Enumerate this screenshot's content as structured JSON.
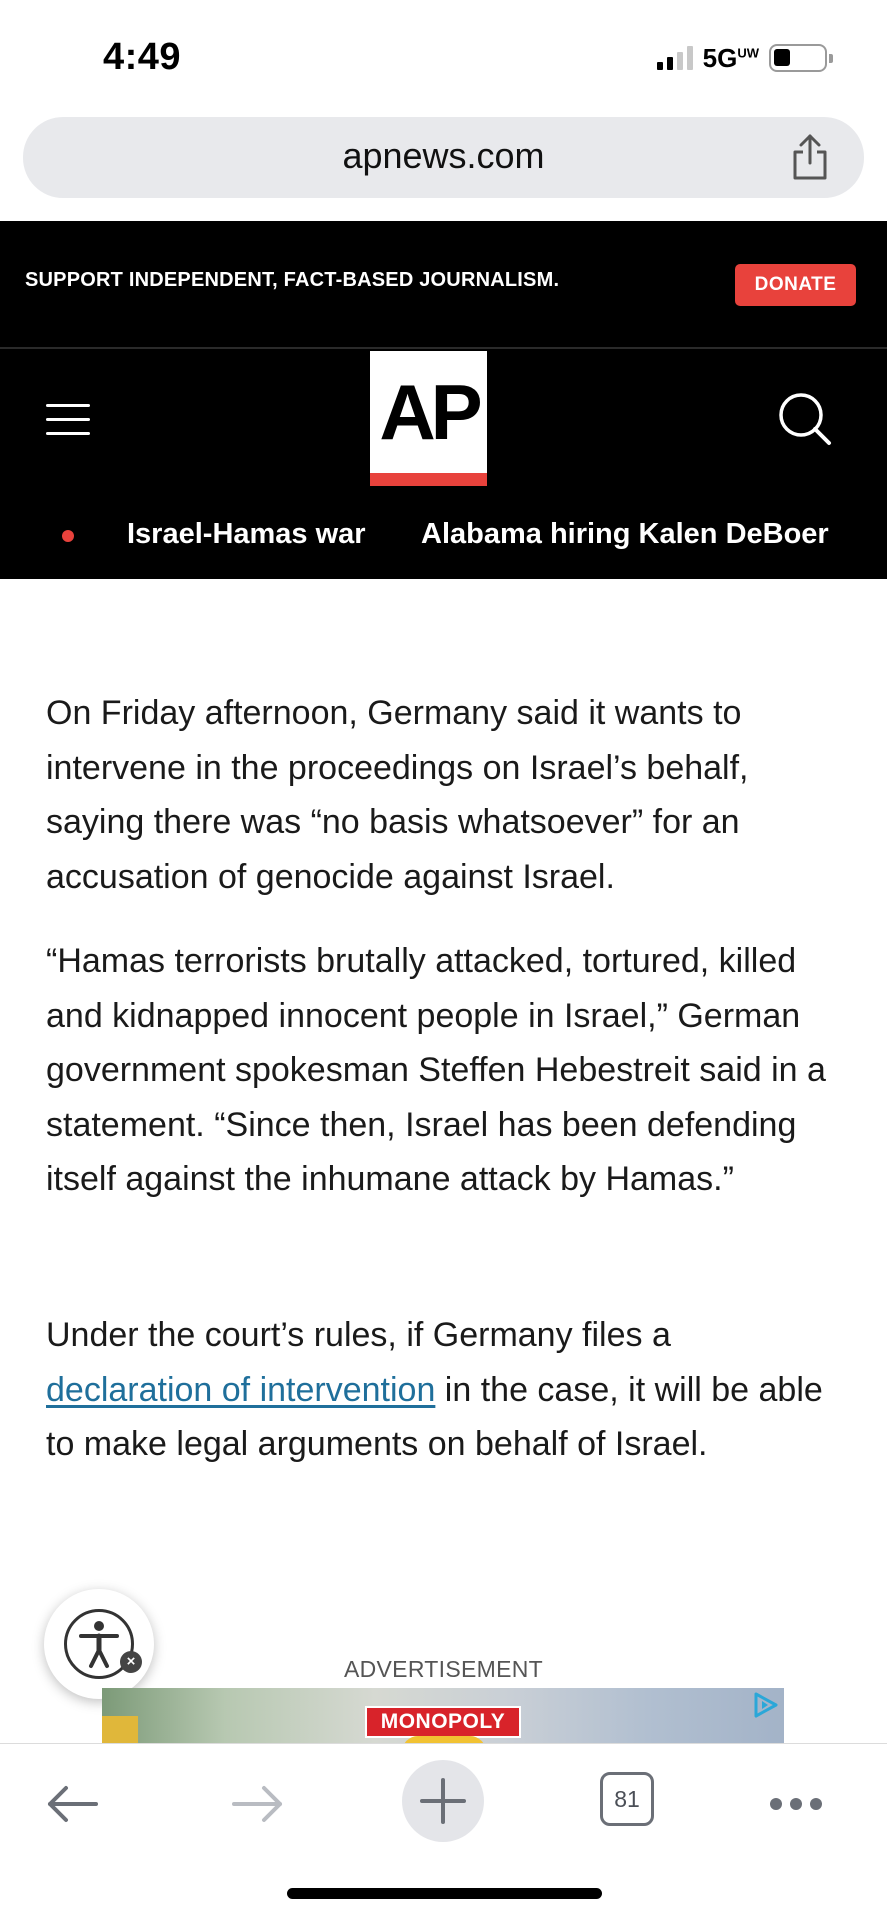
{
  "status_bar": {
    "time": "4:49",
    "network": "5G",
    "network_sup": "UW",
    "signal_bars": 4,
    "signal_bars_active": 2,
    "battery_level": 0.3
  },
  "browser": {
    "url": "apnews.com",
    "share_icon": "share-icon"
  },
  "banner": {
    "text": "SUPPORT INDEPENDENT, FACT-BASED JOURNALISM.",
    "donate_label": "DONATE",
    "donate_color": "#e8423c"
  },
  "header": {
    "logo_text": "AP",
    "menu_icon": "hamburger-icon",
    "search_icon": "search-icon",
    "trending": [
      {
        "label": "Israel-Hamas war"
      },
      {
        "label": "Alabama hiring Kalen DeBoer"
      }
    ]
  },
  "article": {
    "p1": "On Friday afternoon, Germany said it wants to intervene in the proceedings on Israel’s behalf, saying there was “no basis whatsoever” for an accusation of genocide against Israel.",
    "p2": "“Hamas terrorists brutally attacked, tortured, killed and kidnapped innocent people in Israel,” German government spokesman Steffen Hebestreit said in a statement. “Since then, Israel has been defending itself against the inhumane attack by Hamas.”",
    "p3_before": "Under the court’s rules, if Germany files a ",
    "p3_link": "declaration of intervention",
    "p3_after": " in the case, it will be able to make legal arguments on behalf of Israel.",
    "link_color": "#1f6f9b"
  },
  "accessibility": {
    "icon": "accessibility-icon",
    "close_glyph": "×"
  },
  "ad": {
    "label": "ADVERTISEMENT",
    "brand": "MONOPOLY"
  },
  "toolbar": {
    "tab_count": "81",
    "back_icon": "back-arrow-icon",
    "forward_icon": "forward-arrow-icon",
    "new_tab_icon": "plus-icon",
    "more_icon": "more-icon"
  }
}
